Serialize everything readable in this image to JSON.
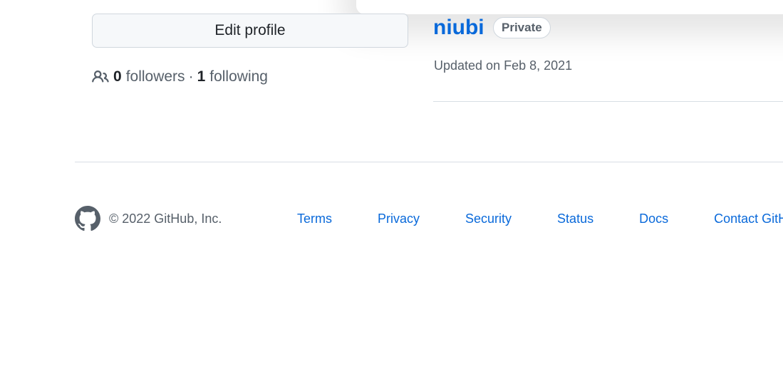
{
  "profile": {
    "edit_button_label": "Edit profile",
    "followers_count": "0",
    "followers_label": "followers",
    "separator": "·",
    "following_count": "1",
    "following_label": "following",
    "people_icon": "people-icon"
  },
  "repo": {
    "name": "niubi",
    "visibility_badge": "Private",
    "updated_text": "Updated on Feb 8, 2021"
  },
  "footer": {
    "logo_icon": "github-mark-icon",
    "copyright": "© 2022 GitHub, Inc.",
    "links": [
      {
        "label": "Terms"
      },
      {
        "label": "Privacy"
      },
      {
        "label": "Security"
      },
      {
        "label": "Status"
      },
      {
        "label": "Docs"
      },
      {
        "label": "Contact GitHub"
      }
    ]
  },
  "colors": {
    "link": "#0969da",
    "muted_text": "#57606a",
    "border": "#d0d7de",
    "button_bg": "#f6f8fa"
  }
}
